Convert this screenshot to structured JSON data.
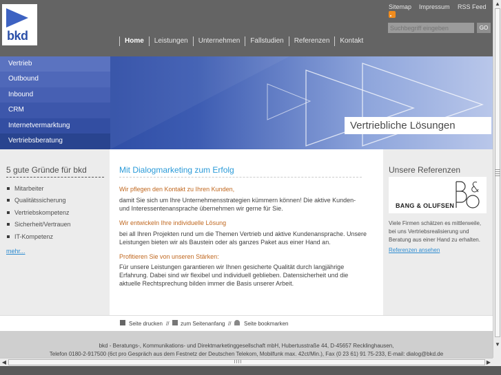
{
  "logo": {
    "text": "bkd"
  },
  "utility": {
    "sitemap": "Sitemap",
    "impressum": "Impressum",
    "rss": "RSS Feed"
  },
  "search": {
    "placeholder": "Suchbegriff eingeben",
    "go": "GO"
  },
  "nav": [
    "Home",
    "Leistungen",
    "Unternehmen",
    "Fallstudien",
    "Referenzen",
    "Kontakt"
  ],
  "sidebar": [
    "Vertrieb",
    "Outbound",
    "Inbound",
    "CRM",
    "Internetvermarktung",
    "Vertriebsberatung"
  ],
  "hero": {
    "caption": "Vertriebliche Lösungen"
  },
  "left": {
    "title": "5 gute Gründe für bkd",
    "items": [
      "Mitarbeiter",
      "Qualitätssicherung",
      "Vertriebskompetenz",
      "Sicherheit/Vertrauen",
      "IT-Kompetenz"
    ],
    "more": "mehr..."
  },
  "main": {
    "title": "Mit Dialogmarketing zum Erfolg",
    "sections": [
      {
        "heading": "Wir pflegen den Kontakt zu Ihren Kunden,",
        "text": "damit Sie sich um Ihre Unternehmensstrategien kümmern können! Die aktive Kunden- und Interessentenansprache übernehmen wir gerne für Sie."
      },
      {
        "heading": "Wir entwickeln Ihre individuelle Lösung",
        "text": "bei all Ihren Projekten rund um die Themen Vertrieb und aktive Kundenansprache. Unsere Leistungen bieten wir als Baustein oder als ganzes Paket aus einer Hand an."
      },
      {
        "heading": "Profitieren Sie von unseren Stärken:",
        "text": "Für unsere Leistungen garantieren wir Ihnen gesicherte Qualität durch langjährige Erfahrung. Dabei sind wir flexibel und individuell geblieben. Datensicherheit und die aktuelle Rechtsprechung bilden immer die Basis unserer Arbeit."
      }
    ]
  },
  "right": {
    "title": "Unsere Referenzen",
    "logo_text": "BANG & OLUFSEN",
    "logo_mark": "B&O",
    "text": "Viele Firmen schätzen es mittlerweile, bei uns Vertriebsrealisierung und Beratung aus einer Hand zu erhalten.",
    "link": "Referenzen ansehen"
  },
  "tools": {
    "print": "Seite drucken",
    "sep": "//",
    "top": "zum Seitenanfang",
    "bookmark": "Seite bookmarken"
  },
  "footer": {
    "line1": "bkd - Beratungs-, Kommunikations- und Direktmarketinggesellschaft mbH, Hubertusstraße 44, D-45657 Recklinghausen,",
    "line2": "Telefon 0180-2-917500 (6ct pro Gespräch aus dem Festnetz der Deutschen Telekom, Mobilfunk max. 42ct/Min.), Fax (0 23 61) 91 75-233, E-mail: dialog@bkd.de"
  },
  "colors": {
    "accent": "#2a9ad8",
    "heading": "#c0671e",
    "brand": "#2a4fa8"
  }
}
